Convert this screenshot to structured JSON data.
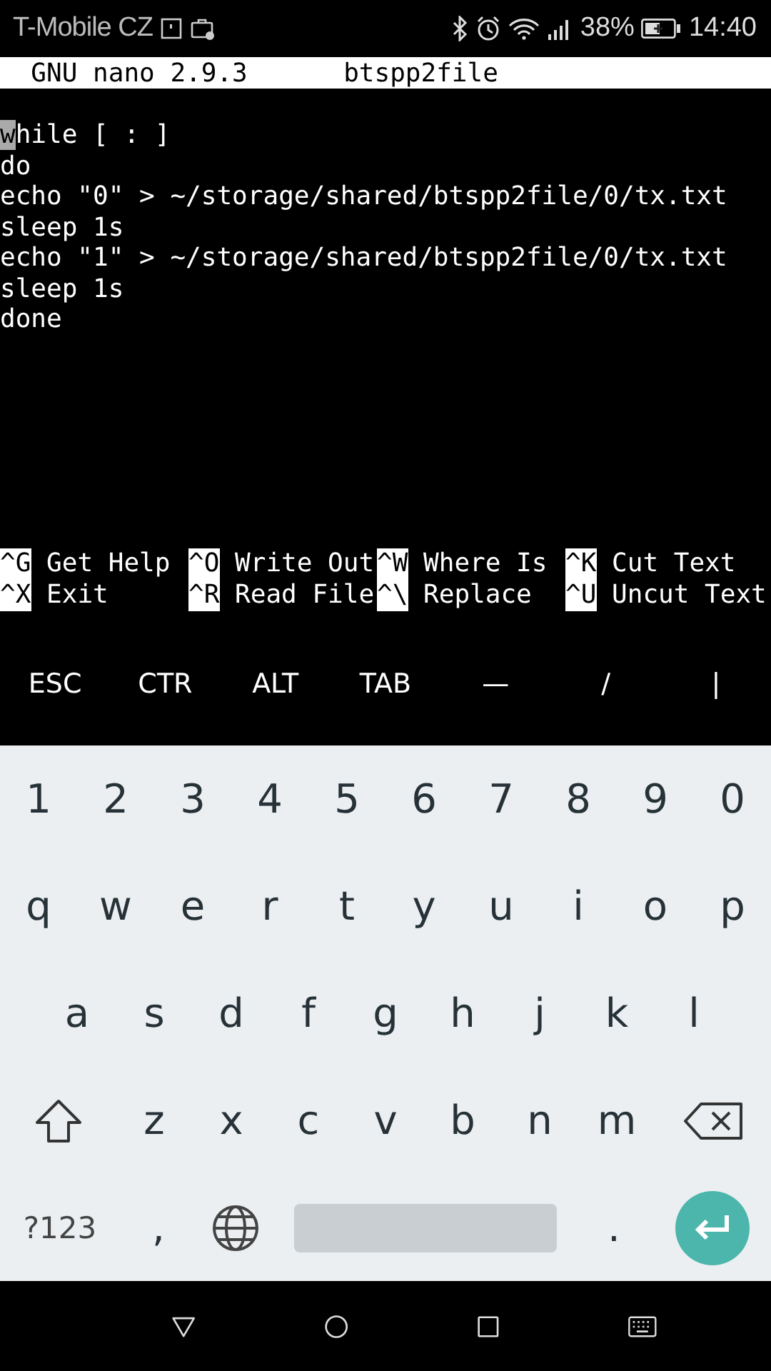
{
  "status_bar": {
    "carrier": "T-Mobile CZ",
    "battery": "38%",
    "time": "14:40"
  },
  "nano": {
    "title": "GNU nano 2.9.3",
    "filename": "btspp2file",
    "lines": [
      {
        "text": "while [ : ]",
        "cursor": true
      },
      {
        "text": "do",
        "cursor": false
      },
      {
        "text": "echo \"0\" > ~/storage/shared/btspp2file/0/tx.txt",
        "cursor": false
      },
      {
        "text": "sleep 1s",
        "cursor": false
      },
      {
        "text": "echo \"1\" > ~/storage/shared/btspp2file/0/tx.txt",
        "cursor": false
      },
      {
        "text": "sleep 1s",
        "cursor": false
      },
      {
        "text": "done",
        "cursor": false
      }
    ],
    "shortcuts": [
      [
        {
          "key": "^G",
          "label": "Get Help"
        },
        {
          "key": "^O",
          "label": "Write Out"
        },
        {
          "key": "^W",
          "label": "Where Is"
        },
        {
          "key": "^K",
          "label": "Cut Text"
        }
      ],
      [
        {
          "key": "^X",
          "label": "Exit"
        },
        {
          "key": "^R",
          "label": "Read File"
        },
        {
          "key": "^\\",
          "label": "Replace"
        },
        {
          "key": "^U",
          "label": "Uncut Text"
        }
      ]
    ]
  },
  "extra_keys": [
    "ESC",
    "CTR",
    "ALT",
    "TAB",
    "—",
    "/",
    "|"
  ],
  "keyboard": {
    "rows": [
      [
        "1",
        "2",
        "3",
        "4",
        "5",
        "6",
        "7",
        "8",
        "9",
        "0"
      ],
      [
        "q",
        "w",
        "e",
        "r",
        "t",
        "y",
        "u",
        "i",
        "o",
        "p"
      ],
      [
        "a",
        "s",
        "d",
        "f",
        "g",
        "h",
        "j",
        "k",
        "l"
      ],
      [
        {
          "kind": "shift"
        },
        {
          "kind": "char",
          "label": "z"
        },
        {
          "kind": "char",
          "label": "x"
        },
        {
          "kind": "char",
          "label": "c"
        },
        {
          "kind": "char",
          "label": "v"
        },
        {
          "kind": "char",
          "label": "b"
        },
        {
          "kind": "char",
          "label": "n"
        },
        {
          "kind": "char",
          "label": "m"
        },
        {
          "kind": "backspace"
        }
      ],
      [
        {
          "kind": "symbols",
          "label": "?123"
        },
        {
          "kind": "char",
          "label": ","
        },
        {
          "kind": "globe"
        },
        {
          "kind": "space"
        },
        {
          "kind": "char",
          "label": "."
        },
        {
          "kind": "enter"
        }
      ]
    ]
  }
}
